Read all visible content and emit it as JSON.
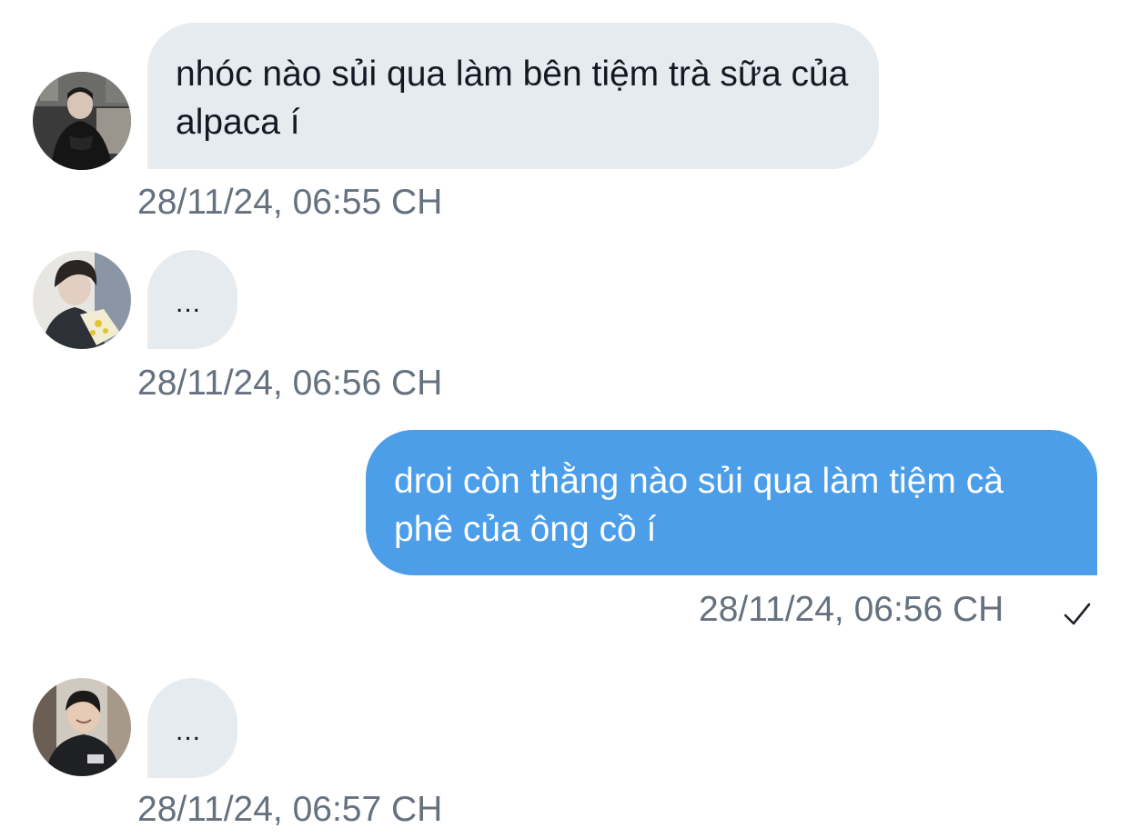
{
  "messages": [
    {
      "direction": "incoming",
      "avatar_icon": "avatar-user-1",
      "text": "nhóc nào sủi qua làm bên tiệm trà sữa của alpaca í",
      "timestamp": "28/11/24, 06:55 CH"
    },
    {
      "direction": "incoming",
      "avatar_icon": "avatar-user-2",
      "text": "...",
      "timestamp": "28/11/24, 06:56 CH"
    },
    {
      "direction": "outgoing",
      "text": "droi còn thằng nào sủi qua làm tiệm cà phê của ông cồ í",
      "timestamp": "28/11/24, 06:56 CH",
      "status_icon": "check-icon",
      "status": "sent"
    },
    {
      "direction": "incoming",
      "avatar_icon": "avatar-user-3",
      "text": "...",
      "timestamp": "28/11/24, 06:57 CH"
    }
  ],
  "colors": {
    "incoming_bubble": "#e6ebf0",
    "outgoing_bubble": "#4c9ee8",
    "incoming_text": "#141823",
    "outgoing_text": "#ffffff",
    "timestamp_text": "#65717f",
    "background": "#ffffff"
  }
}
